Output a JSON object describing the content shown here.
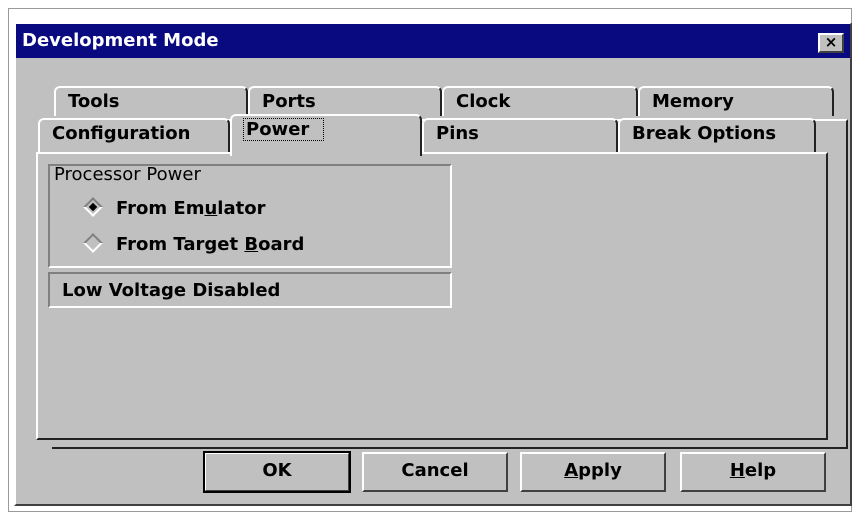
{
  "window": {
    "title": "Development Mode",
    "close_label": "×"
  },
  "tabs": {
    "back_row": [
      "Tools",
      "Ports",
      "Clock",
      "Memory"
    ],
    "front_row": [
      "Configuration",
      "Power",
      "Pins",
      "Break Options"
    ],
    "active": "Power"
  },
  "power": {
    "group_label": "Processor Power",
    "options": [
      {
        "prefix": "From Em",
        "underline": "u",
        "suffix": "lator",
        "selected": true
      },
      {
        "prefix": "From Target ",
        "underline": "B",
        "suffix": "oard",
        "selected": false
      }
    ],
    "status": "Low Voltage Disabled"
  },
  "buttons": {
    "ok": "OK",
    "cancel": "Cancel",
    "apply": {
      "underline": "A",
      "rest": "pply"
    },
    "help": {
      "underline": "H",
      "rest": "elp"
    }
  }
}
